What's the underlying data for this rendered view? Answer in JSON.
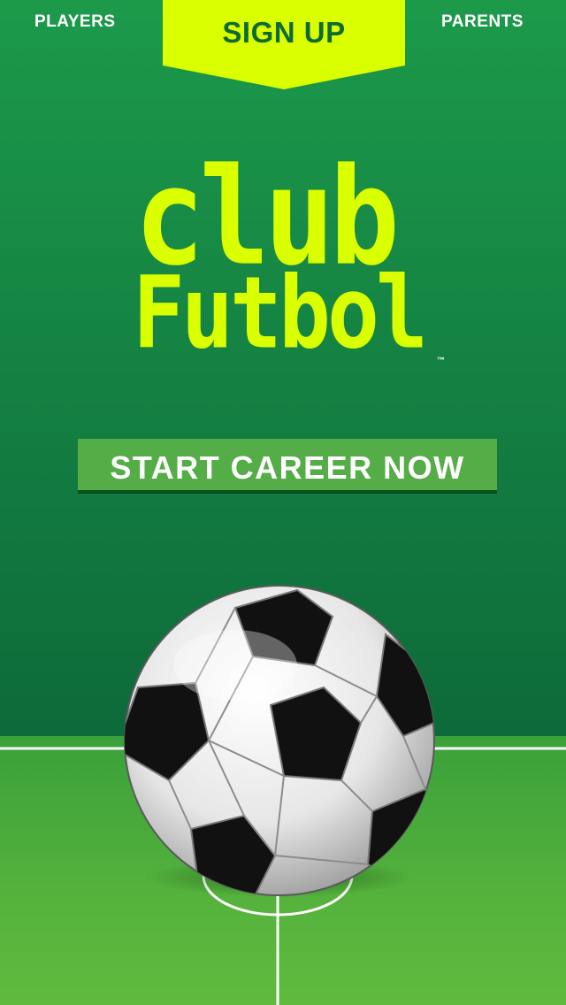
{
  "nav": {
    "players_label": "PLAYERS",
    "parents_label": "PARENTS",
    "signup_label": "SIGN UP"
  },
  "logo": {
    "line1": "club",
    "line2": "Futbol",
    "trademark": "™"
  },
  "cta": {
    "label": "START CAREER NOW"
  },
  "colors": {
    "accent_yellow": "#d9ff00",
    "dark_green": "#0e6a35",
    "button_green": "#54ad47",
    "field_green": "#4fad3c"
  },
  "icons": {
    "ball": "soccer-ball-icon"
  }
}
